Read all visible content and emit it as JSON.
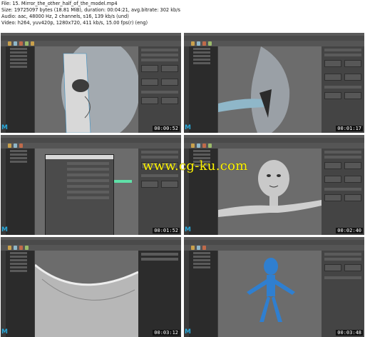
{
  "header": {
    "file": "File: 15. Mirror_the_other_half_of_the_model.mp4",
    "size": "Size: 19725097 bytes (18.81 MiB), duration: 00:04:21, avg.bitrate: 302 kb/s",
    "audio": "Audio: aac, 48000 Hz, 2 channels, s16, 139 kb/s (und)",
    "video": "Video: h264, yuv420p, 1280x720, 411 kb/s, 15.00 fps(r) (eng)"
  },
  "watermark": "www.cg-ku.com",
  "thumbnails": [
    {
      "timecode": "00:00:52",
      "app_logo": "M"
    },
    {
      "timecode": "00:01:17",
      "app_logo": "M"
    },
    {
      "timecode": "00:01:52",
      "app_logo": "M"
    },
    {
      "timecode": "00:02:40",
      "app_logo": "M"
    },
    {
      "timecode": "00:03:12",
      "app_logo": "M"
    },
    {
      "timecode": "00:03:48",
      "app_logo": "M"
    }
  ],
  "colors": {
    "watermark": "#fff500",
    "maya_blue": "#2aa7d8",
    "background": "#ffffff"
  }
}
